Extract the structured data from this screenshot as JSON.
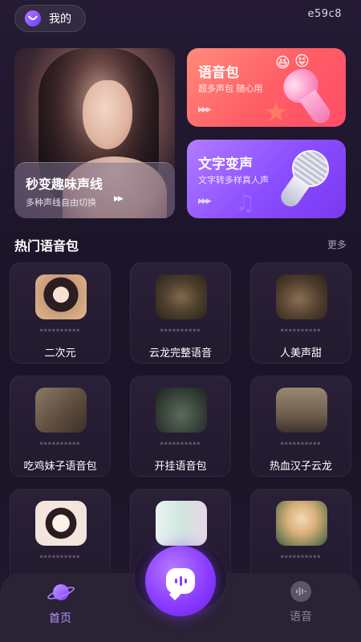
{
  "header": {
    "mine_label": "我的",
    "code": "e59c8"
  },
  "hero": {
    "title": "秒变趣味声线",
    "subtitle": "多种声线自由切换",
    "play_glyph": "▶▶"
  },
  "voice_pack_card": {
    "title": "语音包",
    "subtitle": "超多声包 随心用",
    "play_glyph": "▶▶▶"
  },
  "text_change_card": {
    "title": "文字变声",
    "subtitle": "文字转多样真人声",
    "play_glyph": "▶▶▶"
  },
  "section": {
    "title": "热门语音包",
    "more": "更多"
  },
  "grid": {
    "dots": "▪▪▪▪▪▪▪▪▪▪",
    "items": [
      {
        "name": "二次元"
      },
      {
        "name": "云龙完整语音"
      },
      {
        "name": "人美声甜"
      },
      {
        "name": "吃鸡妹子语音包"
      },
      {
        "name": "开挂语音包"
      },
      {
        "name": "热血汉子云龙"
      },
      {
        "name": ""
      },
      {
        "name": ""
      },
      {
        "name": ""
      }
    ]
  },
  "nav": {
    "home": "首页",
    "voice": "语音"
  },
  "colors": {
    "accent": "#8a3cff",
    "voice_card": "#ff5d66",
    "text_card": "#8a4dff",
    "background": "#1c1529"
  }
}
